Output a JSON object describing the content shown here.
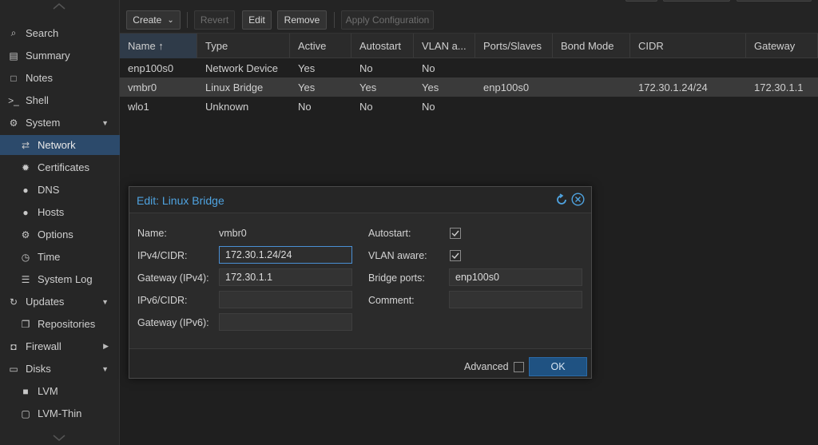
{
  "sidebar": {
    "items": [
      {
        "label": "Search",
        "icon": "search-icon",
        "glyph": "⌕",
        "level": 0
      },
      {
        "label": "Summary",
        "icon": "book-icon",
        "glyph": "▤",
        "level": 0
      },
      {
        "label": "Notes",
        "icon": "notes-icon",
        "glyph": "□",
        "level": 0
      },
      {
        "label": "Shell",
        "icon": "terminal-icon",
        "glyph": ">_",
        "level": 0
      },
      {
        "label": "System",
        "icon": "gears-icon",
        "glyph": "⚙",
        "level": 0,
        "arrow": "▼"
      },
      {
        "label": "Network",
        "icon": "exchange-icon",
        "glyph": "⇄",
        "level": 1,
        "selected": true
      },
      {
        "label": "Certificates",
        "icon": "certificate-icon",
        "glyph": "✹",
        "level": 1
      },
      {
        "label": "DNS",
        "icon": "globe-icon",
        "glyph": "●",
        "level": 1
      },
      {
        "label": "Hosts",
        "icon": "globe-icon",
        "glyph": "●",
        "level": 1
      },
      {
        "label": "Options",
        "icon": "gear-icon",
        "glyph": "⚙",
        "level": 1
      },
      {
        "label": "Time",
        "icon": "clock-icon",
        "glyph": "◷",
        "level": 1
      },
      {
        "label": "System Log",
        "icon": "list-icon",
        "glyph": "☰",
        "level": 1
      },
      {
        "label": "Updates",
        "icon": "refresh-icon",
        "glyph": "↻",
        "level": 0,
        "arrow": "▼"
      },
      {
        "label": "Repositories",
        "icon": "files-icon",
        "glyph": "❐",
        "level": 1
      },
      {
        "label": "Firewall",
        "icon": "shield-icon",
        "glyph": "◘",
        "level": 0,
        "arrow": "▶"
      },
      {
        "label": "Disks",
        "icon": "hdd-icon",
        "glyph": "▭",
        "level": 0,
        "arrow": "▼"
      },
      {
        "label": "LVM",
        "icon": "square-icon",
        "glyph": "■",
        "level": 1
      },
      {
        "label": "LVM-Thin",
        "icon": "square-outline-icon",
        "glyph": "▢",
        "level": 1
      }
    ]
  },
  "toolbar": {
    "create": "Create",
    "revert": "Revert",
    "edit": "Edit",
    "remove": "Remove",
    "apply": "Apply Configuration"
  },
  "grid": {
    "columns": [
      "Name ↑",
      "Type",
      "Active",
      "Autostart",
      "VLAN a...",
      "Ports/Slaves",
      "Bond Mode",
      "CIDR",
      "Gateway"
    ],
    "rows": [
      [
        "enp100s0",
        "Network Device",
        "Yes",
        "No",
        "No",
        "",
        "",
        "",
        ""
      ],
      [
        "vmbr0",
        "Linux Bridge",
        "Yes",
        "Yes",
        "Yes",
        "enp100s0",
        "",
        "172.30.1.24/24",
        "172.30.1.1"
      ],
      [
        "wlo1",
        "Unknown",
        "No",
        "No",
        "No",
        "",
        "",
        "",
        ""
      ]
    ],
    "selected_row": 1
  },
  "modal": {
    "title": "Edit: Linux Bridge",
    "name_label": "Name:",
    "name_value": "vmbr0",
    "ipv4_label": "IPv4/CIDR:",
    "ipv4_value": "172.30.1.24/24",
    "gw4_label": "Gateway (IPv4):",
    "gw4_value": "172.30.1.1",
    "ipv6_label": "IPv6/CIDR:",
    "ipv6_value": "",
    "gw6_label": "Gateway (IPv6):",
    "gw6_value": "",
    "autostart_label": "Autostart:",
    "autostart_checked": true,
    "vlan_label": "VLAN aware:",
    "vlan_checked": true,
    "bridge_label": "Bridge ports:",
    "bridge_value": "enp100s0",
    "comment_label": "Comment:",
    "comment_value": "",
    "advanced_label": "Advanced",
    "advanced_checked": false,
    "ok_label": "OK"
  },
  "colors": {
    "accent": "#4fa3e0",
    "selected_nav": "#2c4a6b",
    "ok_button": "#1f5282"
  }
}
